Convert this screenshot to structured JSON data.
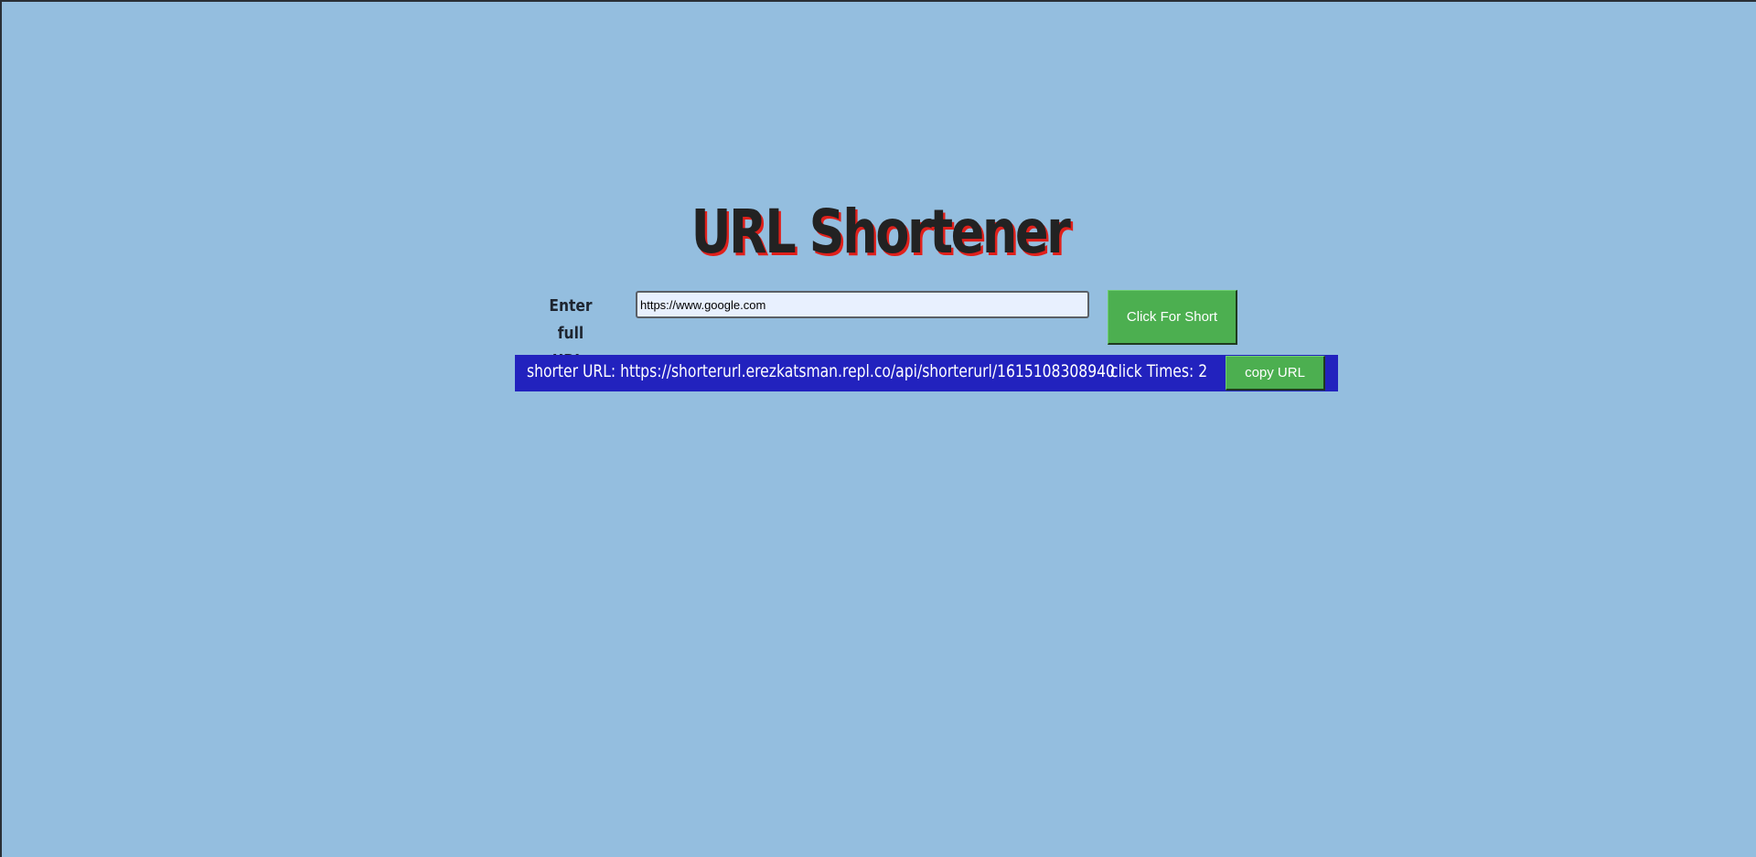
{
  "page": {
    "title": "URL Shortener"
  },
  "form": {
    "label": "Enter full URL:",
    "input_value": "https://www.google.com",
    "submit_label": "Click For Short"
  },
  "result": {
    "shorter_url_text": "shorter URL: https://shorterurl.erezkatsman.repl.co/api/shorterurl/1615108308940",
    "click_times_text": "click Times: 2",
    "copy_label": "copy URL"
  },
  "colors": {
    "background": "#94bedf",
    "title_shadow": "#e0201b",
    "button_green": "#4caf50",
    "result_bar": "#2222be"
  }
}
